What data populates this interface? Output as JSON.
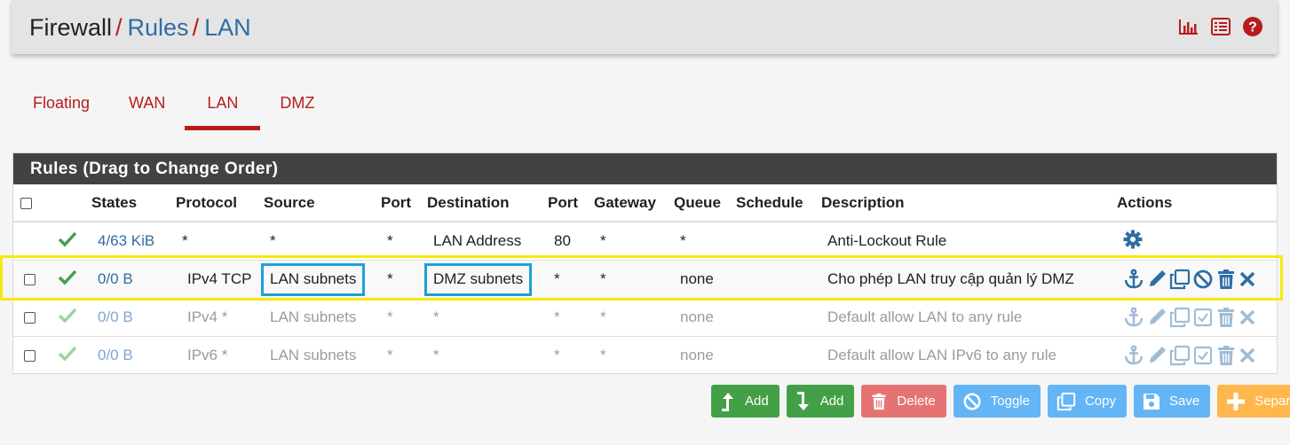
{
  "breadcrumb": {
    "root": "Firewall",
    "separator": "/",
    "level1": "Rules",
    "level2": "LAN"
  },
  "header_icons": [
    "bar-chart-icon",
    "list-icon",
    "help-icon"
  ],
  "tabs": [
    {
      "label": "Floating",
      "active": false
    },
    {
      "label": "WAN",
      "active": false
    },
    {
      "label": "LAN",
      "active": true
    },
    {
      "label": "DMZ",
      "active": false
    }
  ],
  "panel": {
    "title": "Rules (Drag to Change Order)"
  },
  "table": {
    "headers": {
      "states": "States",
      "protocol": "Protocol",
      "source": "Source",
      "port": "Port",
      "destination": "Destination",
      "dport": "Port",
      "gateway": "Gateway",
      "queue": "Queue",
      "schedule": "Schedule",
      "description": "Description",
      "actions": "Actions"
    },
    "rows": [
      {
        "states": "4/63 KiB",
        "protocol": "*",
        "source": "*",
        "port": "*",
        "destination": "LAN Address",
        "dport": "80",
        "gateway": "*",
        "queue": "*",
        "schedule": "",
        "description": "Anti-Lockout Rule",
        "enabled": true
      },
      {
        "states": "0/0 B",
        "protocol": "IPv4 TCP",
        "source": "LAN subnets",
        "port": "*",
        "destination": "DMZ subnets",
        "dport": "*",
        "gateway": "*",
        "queue": "none",
        "schedule": "",
        "description": "Cho phép LAN truy cập quản lý DMZ",
        "enabled": true
      },
      {
        "states": "0/0 B",
        "protocol": "IPv4 *",
        "source": "LAN subnets",
        "port": "*",
        "destination": "*",
        "dport": "*",
        "gateway": "*",
        "queue": "none",
        "schedule": "",
        "description": "Default allow LAN to any rule",
        "enabled": false
      },
      {
        "states": "0/0 B",
        "protocol": "IPv6 *",
        "source": "LAN subnets",
        "port": "*",
        "destination": "*",
        "dport": "*",
        "gateway": "*",
        "queue": "none",
        "schedule": "",
        "description": "Default allow LAN IPv6 to any rule",
        "enabled": false
      }
    ]
  },
  "buttons": {
    "add_top": "Add",
    "add_bottom": "Add",
    "delete": "Delete",
    "toggle": "Toggle",
    "copy": "Copy",
    "save": "Save",
    "separator": "Separator"
  },
  "colors": {
    "accent_red": "#b71c1c",
    "link_blue": "#2e6da4",
    "check_green": "#43a047",
    "highlight_yellow": "#f5ea0c",
    "highlight_cyan": "#1e9fd6"
  }
}
